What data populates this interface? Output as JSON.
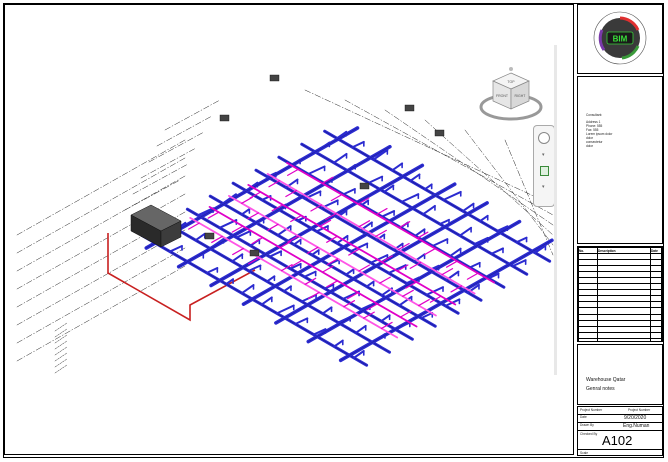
{
  "title_block": {
    "logo_text": "BIM",
    "notes_lines": [
      "Consultant:",
      "Address 1",
      "Phone: 555",
      "Fax: 555",
      "Lorem ipsum dolor",
      "dolor",
      "consectetur",
      "dolor"
    ],
    "revision_headers": {
      "no": "No.",
      "description": "Description",
      "date": "Date"
    },
    "project_name": "Warehouse Qatar",
    "sheet_name": "Genral notes",
    "project_number_label": "Project Number",
    "project_number_value": "Project Number",
    "date_label": "Date",
    "date_value": "9/20/2020",
    "drawn_by_label": "Drawn By",
    "drawn_by_value": "Eng.Numan",
    "checked_by_label": "Checked By",
    "sheet_number": "A102",
    "scale_label": "Scale"
  },
  "view_cube": {
    "faces": [
      "FRONT",
      "RIGHT",
      "TOP"
    ]
  },
  "colors": {
    "duct_blue": "#2b2bd0",
    "duct_dark": "#1a1a8f",
    "pipe_magenta": "#e000c8",
    "pipe_pink": "#ff55e6",
    "frame_red": "#c82020",
    "grid_dash": "#222222"
  }
}
